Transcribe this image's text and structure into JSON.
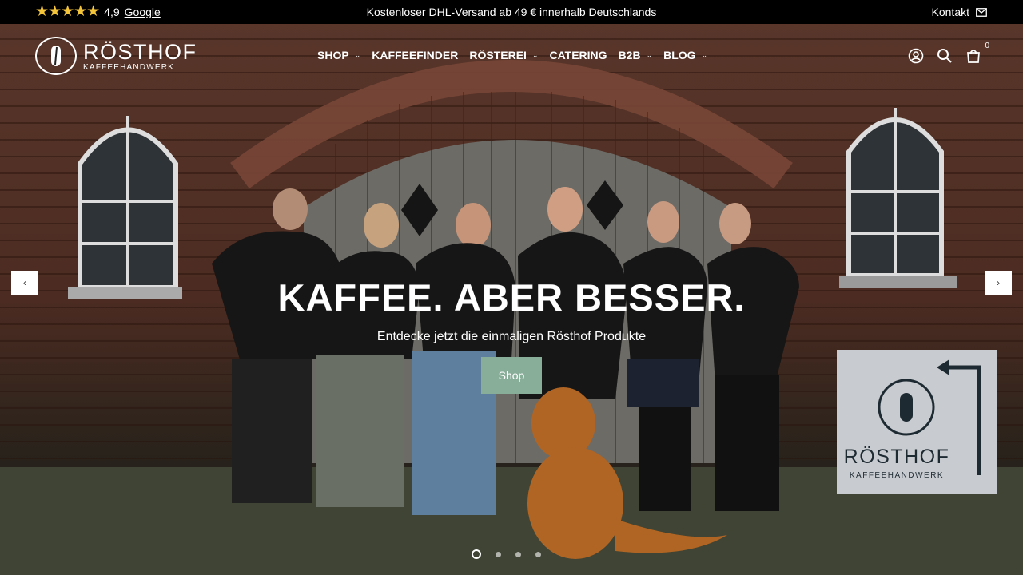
{
  "topbar": {
    "stars": "★★★★★",
    "rating_value": "4,9",
    "rating_source": "Google",
    "announcement": "Kostenloser DHL-Versand ab 49 € innerhalb Deutschlands",
    "contact_label": "Kontakt"
  },
  "header": {
    "logo_name": "RÖSTHOF",
    "logo_sub": "KAFFEEHANDWERK",
    "nav": [
      {
        "label": "SHOP",
        "has_dropdown": true
      },
      {
        "label": "KAFFEEFINDER",
        "has_dropdown": false
      },
      {
        "label": "RÖSTEREI",
        "has_dropdown": true
      },
      {
        "label": "CATERING",
        "has_dropdown": false
      },
      {
        "label": "B2B",
        "has_dropdown": true
      },
      {
        "label": "BLOG",
        "has_dropdown": true
      }
    ],
    "icons": [
      "account-icon",
      "search-icon",
      "cart-icon"
    ],
    "cart_count": "0"
  },
  "hero": {
    "title": "KAFFEE. ABER BESSER.",
    "subtitle": "Entdecke jetzt die einmaligen Rösthof Produkte",
    "button_label": "Shop",
    "sign_name": "RÖSTHOF",
    "sign_sub": "KAFFEEHANDWERK",
    "slides_count": 4,
    "active_slide": 1,
    "prev_arrow": "‹",
    "next_arrow": "›"
  },
  "colors": {
    "topbar_bg": "#000000",
    "button_bg": "#88ad98",
    "stars": "#f4c53b"
  }
}
